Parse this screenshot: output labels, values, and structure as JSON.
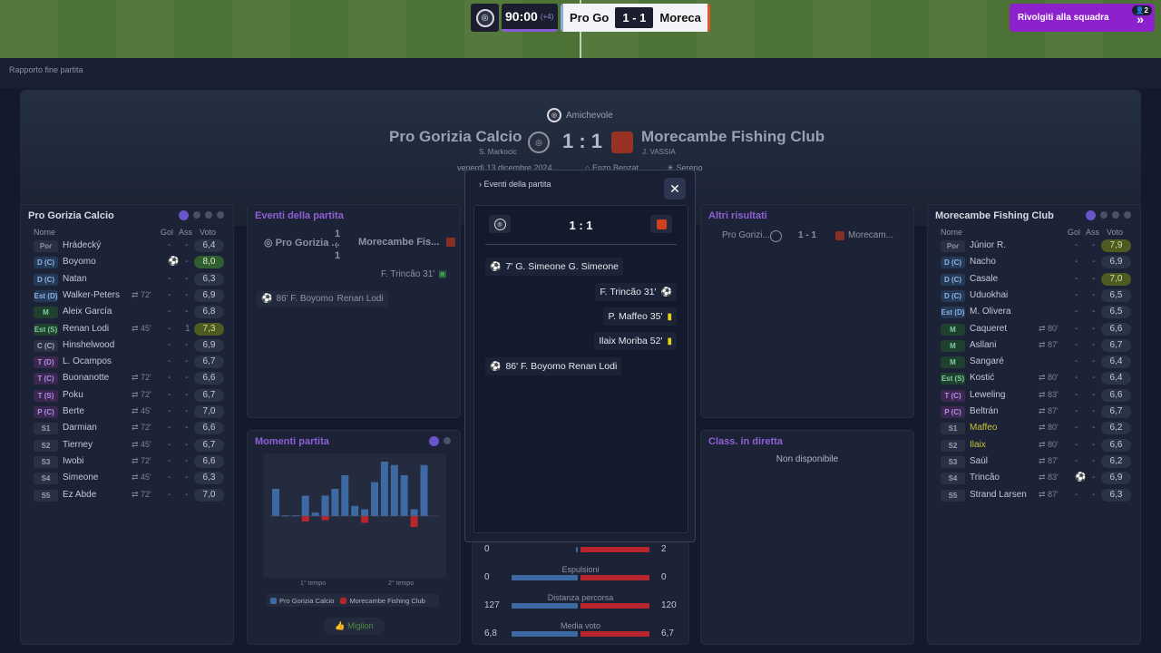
{
  "topbar": {
    "time": "90:00",
    "added": "(+4)",
    "home_short": "Pro Go",
    "score": "1 - 1",
    "away_short": "Moreca",
    "cta": "Rivolgiti alla squadra",
    "badge": "2"
  },
  "page": {
    "breadcrumb": "Rapporto fine partita"
  },
  "header": {
    "competition": "Amichevole",
    "home": "Pro Gorizia Calcio",
    "home_coach": "S. Markocic",
    "score": "1 : 1",
    "away": "Morecambe Fishing Club",
    "away_coach": "J. VASSIA",
    "date": "venerdì 13 dicembre 2024",
    "stadium": "Enzo Benzat",
    "weather": "Sereno"
  },
  "home_panel": {
    "title": "Pro Gorizia Calcio",
    "cols": {
      "name": "Nome",
      "gol": "Gol",
      "ass": "Ass",
      "voto": "Voto"
    },
    "players": [
      {
        "pos": "Por",
        "name": "Hrádecký",
        "sub": "",
        "gol": "-",
        "ass": "-",
        "voto": "6,4",
        "vc": "",
        "pc": "pP"
      },
      {
        "pos": "D (C)",
        "name": "Boyomo",
        "sub": "",
        "gol": "⚽",
        "ass": "-",
        "voto": "8,0",
        "vc": "g",
        "pc": "pD"
      },
      {
        "pos": "D (C)",
        "name": "Natan",
        "sub": "",
        "gol": "-",
        "ass": "-",
        "voto": "6,3",
        "vc": "",
        "pc": "pD"
      },
      {
        "pos": "Est (D)",
        "name": "Walker-Peters",
        "sub": "⇄ 72'",
        "gol": "-",
        "ass": "-",
        "voto": "6,9",
        "vc": "",
        "pc": "pD"
      },
      {
        "pos": "M",
        "name": "Aleix García",
        "sub": "",
        "gol": "-",
        "ass": "-",
        "voto": "6,8",
        "vc": "",
        "pc": "pM"
      },
      {
        "pos": "Est (S)",
        "name": "Renan Lodi",
        "sub": "⇄ 45'",
        "gol": "-",
        "ass": "1",
        "voto": "7,3",
        "vc": "y",
        "pc": "pM"
      },
      {
        "pos": "C (C)",
        "name": "Hinshelwood",
        "sub": "",
        "gol": "-",
        "ass": "-",
        "voto": "6,9",
        "vc": "",
        "pc": "pC"
      },
      {
        "pos": "T (D)",
        "name": "L. Ocampos",
        "sub": "",
        "gol": "-",
        "ass": "-",
        "voto": "6,7",
        "vc": "",
        "pc": "pT"
      },
      {
        "pos": "T (C)",
        "name": "Buonanotte",
        "sub": "⇄ 72'",
        "gol": "-",
        "ass": "-",
        "voto": "6,6",
        "vc": "",
        "pc": "pT"
      },
      {
        "pos": "T (S)",
        "name": "Poku",
        "sub": "⇄ 72'",
        "gol": "-",
        "ass": "-",
        "voto": "6,7",
        "vc": "",
        "pc": "pT"
      },
      {
        "pos": "P (C)",
        "name": "Berte",
        "sub": "⇄ 45'",
        "gol": "-",
        "ass": "-",
        "voto": "7,0",
        "vc": "",
        "pc": "pT"
      },
      {
        "pos": "S1",
        "name": "Darmian",
        "sub": "⇄ 72'",
        "gol": "-",
        "ass": "-",
        "voto": "6,6",
        "vc": "",
        "pc": "pS"
      },
      {
        "pos": "S2",
        "name": "Tierney",
        "sub": "⇄ 45'",
        "gol": "-",
        "ass": "-",
        "voto": "6,7",
        "vc": "",
        "pc": "pS"
      },
      {
        "pos": "S3",
        "name": "Iwobi",
        "sub": "⇄ 72'",
        "gol": "-",
        "ass": "-",
        "voto": "6,6",
        "vc": "",
        "pc": "pS"
      },
      {
        "pos": "S4",
        "name": "Simeone",
        "sub": "⇄ 45'",
        "gol": "-",
        "ass": "-",
        "voto": "6,3",
        "vc": "",
        "pc": "pS"
      },
      {
        "pos": "S5",
        "name": "Ez Abde",
        "sub": "⇄ 72'",
        "gol": "-",
        "ass": "-",
        "voto": "7,0",
        "vc": "",
        "pc": "pS"
      }
    ]
  },
  "away_panel": {
    "title": "Morecambe Fishing Club",
    "cols": {
      "name": "Nome",
      "gol": "Gol",
      "ass": "Ass",
      "voto": "Voto"
    },
    "players": [
      {
        "pos": "Por",
        "name": "Júnior R.",
        "sub": "",
        "gol": "-",
        "ass": "-",
        "voto": "7,9",
        "vc": "y",
        "pc": "pP"
      },
      {
        "pos": "D (C)",
        "name": "Nacho",
        "sub": "",
        "gol": "-",
        "ass": "-",
        "voto": "6,9",
        "vc": "",
        "pc": "pD"
      },
      {
        "pos": "D (C)",
        "name": "Casale",
        "sub": "",
        "gol": "-",
        "ass": "-",
        "voto": "7,0",
        "vc": "y",
        "pc": "pD"
      },
      {
        "pos": "D (C)",
        "name": "Uduokhai",
        "sub": "",
        "gol": "-",
        "ass": "-",
        "voto": "6,5",
        "vc": "",
        "pc": "pD"
      },
      {
        "pos": "Est (D)",
        "name": "M. Olivera",
        "sub": "",
        "gol": "-",
        "ass": "-",
        "voto": "6,5",
        "vc": "",
        "pc": "pD"
      },
      {
        "pos": "M",
        "name": "Caqueret",
        "sub": "⇄ 80'",
        "gol": "-",
        "ass": "-",
        "voto": "6,6",
        "vc": "",
        "pc": "pM"
      },
      {
        "pos": "M",
        "name": "Asllani",
        "sub": "⇄ 87'",
        "gol": "-",
        "ass": "-",
        "voto": "6,7",
        "vc": "",
        "pc": "pM"
      },
      {
        "pos": "M",
        "name": "Sangaré",
        "sub": "",
        "gol": "-",
        "ass": "-",
        "voto": "6,4",
        "vc": "",
        "pc": "pM"
      },
      {
        "pos": "Est (S)",
        "name": "Kostić",
        "sub": "⇄ 80'",
        "gol": "-",
        "ass": "-",
        "voto": "6,4",
        "vc": "",
        "pc": "pM"
      },
      {
        "pos": "T (C)",
        "name": "Leweling",
        "sub": "⇄ 83'",
        "gol": "-",
        "ass": "-",
        "voto": "6,6",
        "vc": "",
        "pc": "pT"
      },
      {
        "pos": "P (C)",
        "name": "Beltrán",
        "sub": "⇄ 87'",
        "gol": "-",
        "ass": "-",
        "voto": "6,7",
        "vc": "",
        "pc": "pT"
      },
      {
        "pos": "S1",
        "name": "Maffeo",
        "sub": "⇄ 80'",
        "gol": "-",
        "ass": "-",
        "voto": "6,2",
        "vc": "",
        "pc": "pS",
        "nc": "#c7c13a"
      },
      {
        "pos": "S2",
        "name": "Ilaix",
        "sub": "⇄ 80'",
        "gol": "-",
        "ass": "-",
        "voto": "6,6",
        "vc": "",
        "pc": "pS",
        "nc": "#c7c13a"
      },
      {
        "pos": "S3",
        "name": "Saúl",
        "sub": "⇄ 87'",
        "gol": "-",
        "ass": "-",
        "voto": "6,2",
        "vc": "",
        "pc": "pS"
      },
      {
        "pos": "S4",
        "name": "Trincão",
        "sub": "⇄ 83'",
        "gol": "⚽",
        "ass": "-",
        "voto": "6,9",
        "vc": "",
        "pc": "pS"
      },
      {
        "pos": "S5",
        "name": "Strand Larsen",
        "sub": "⇄ 87'",
        "gol": "-",
        "ass": "-",
        "voto": "6,3",
        "vc": "",
        "pc": "pS"
      }
    ]
  },
  "events_panel": {
    "title": "Eventi della partita",
    "home": "Pro Gorizia ...",
    "score": "1 : 1",
    "away": "Morecambe Fis...",
    "ev1": "F. Trincão  31'",
    "ev2": "86'  F. Boyomo",
    "ev2b": "Renan Lodi"
  },
  "altri": {
    "title": "Altri risultati",
    "home": "Pro Gorizi...",
    "score": "1 - 1",
    "away": "Morecam..."
  },
  "moments": {
    "title": "Momenti partita",
    "t1": "1° tempo",
    "t2": "2° tempo",
    "legend_home": "Pro Gorizia Calcio",
    "legend_away": "Morecambe Fishing Club",
    "button": "Migliori"
  },
  "classifica": {
    "title": "Class. in diretta",
    "status": "Non disponibile"
  },
  "stats": [
    {
      "label": "",
      "home": "0",
      "away": "2",
      "hv": 0.03,
      "av": 1.0
    },
    {
      "label": "Espulsioni",
      "home": "0",
      "away": "0",
      "hv": 1,
      "av": 1
    },
    {
      "label": "Distanza percorsa",
      "home": "127",
      "away": "120",
      "hv": 1,
      "av": 1
    },
    {
      "label": "Media voto",
      "home": "6,8",
      "away": "6,7",
      "hv": 1,
      "av": 1
    }
  ],
  "modal": {
    "title": "Eventi della partita",
    "score": "1 : 1",
    "events": [
      {
        "side": "home",
        "text": "7'  G. Simeone  G. Simeone",
        "icon": "own-goal-icon"
      },
      {
        "side": "away",
        "text": "F. Trincão  31'",
        "icon": "goal-icon"
      },
      {
        "side": "away",
        "text": "P. Maffeo  35'",
        "icon": "yellow-card-icon"
      },
      {
        "side": "away",
        "text": "Ilaix Moriba  52'",
        "icon": "yellow-card-icon"
      },
      {
        "side": "home",
        "text": "86'  F. Boyomo  Renan Lodi",
        "icon": "goal-icon"
      }
    ]
  },
  "chart_data": {
    "type": "bar",
    "series": [
      {
        "name": "Pro Gorizia Calcio",
        "values": [
          4,
          0.1,
          0.1,
          3,
          0.5,
          3,
          4,
          6,
          1.5,
          1,
          5,
          8,
          7.5,
          6,
          1,
          7.5
        ]
      },
      {
        "name": "Morecambe Fishing Club",
        "values": [
          0,
          0,
          0,
          0.8,
          0,
          0.6,
          0,
          0,
          0,
          1,
          0,
          0,
          0,
          0,
          1.6,
          0
        ]
      }
    ],
    "colors": {
      "home": "#3d6aa3",
      "away": "#b8252c"
    }
  }
}
